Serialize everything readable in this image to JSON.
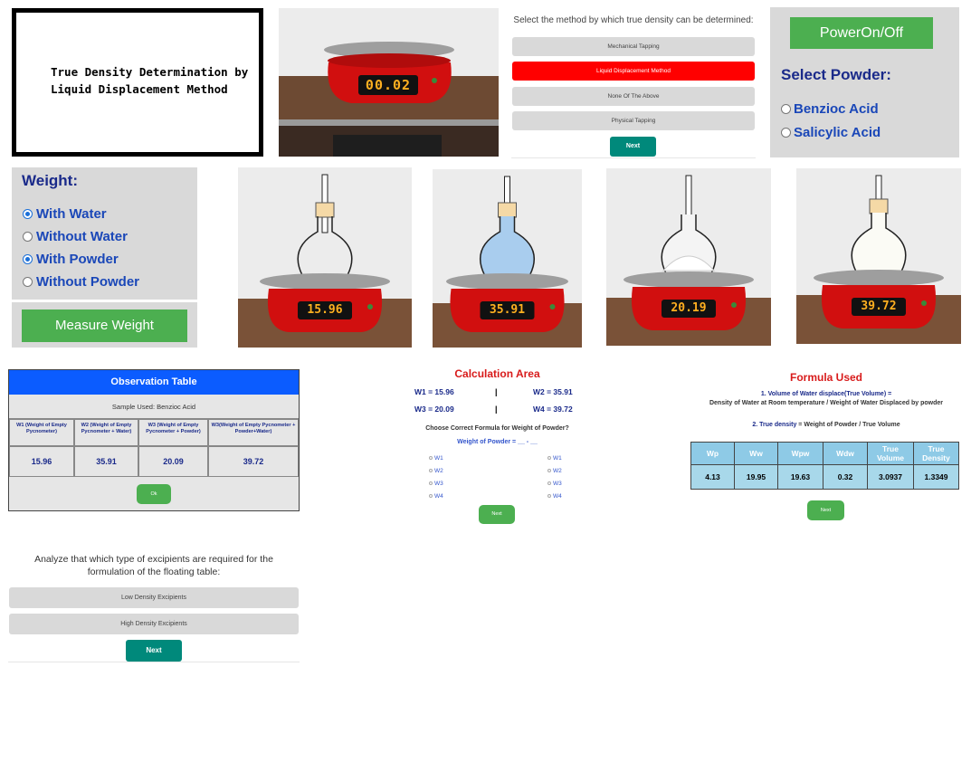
{
  "title_panel": {
    "line1": "True Density Determination by",
    "line2": "Liquid Displacement Method"
  },
  "top_scale": {
    "display": "00.02"
  },
  "method_quiz": {
    "question": "Select the method by which true density can be determined:",
    "options": [
      "Mechanical Tapping",
      "Liquid Displacement Method",
      "None Of The Above",
      "Physical Tapping"
    ],
    "selected": "Liquid Displacement Method",
    "next_label": "Next"
  },
  "power_panel": {
    "power_label": "PowerOn/Off",
    "select_label": "Select Powder:",
    "powders": [
      "Benzioc Acid",
      "Salicylic Acid"
    ]
  },
  "weight_panel": {
    "title": "Weight:",
    "options": [
      {
        "label": "With Water",
        "checked": true
      },
      {
        "label": "Without Water",
        "checked": false
      },
      {
        "label": "With Powder",
        "checked": true
      },
      {
        "label": "Without Powder",
        "checked": false
      }
    ],
    "measure_label": "Measure Weight"
  },
  "flask_scenes": [
    {
      "display": "15.96",
      "contents": "empty"
    },
    {
      "display": "35.91",
      "contents": "water"
    },
    {
      "display": "20.19",
      "contents": "powder"
    },
    {
      "display": "39.72",
      "contents": "powder+water"
    }
  ],
  "observation_table": {
    "title": "Observation Table",
    "sample": "Sample Used: Benzioc Acid",
    "headers": [
      "W1 (Weight of Empty Pycnometer)",
      "W2 (Weight of Empty Pycnometer + Water)",
      "W3 (Weight of Empty Pycnometer + Powder)",
      "W3(Weight of Empty Pycnometer + Powder+Water)"
    ],
    "values": [
      "15.96",
      "35.91",
      "20.09",
      "39.72"
    ],
    "ok_label": "Ok"
  },
  "calculation": {
    "title": "Calculation Area",
    "w1": "W1 = 15.96",
    "w2": "W2 = 35.91",
    "w3": "W3 = 20.09",
    "w4": "W4 = 39.72",
    "sep": "|",
    "question": "Choose Correct Formula for Weight of Powder?",
    "formula": "Weight of Powder = __ - __",
    "left_options": [
      "W1",
      "W2",
      "W3",
      "W4"
    ],
    "right_options": [
      "W1",
      "W2",
      "W3",
      "W4"
    ],
    "next_label": "Next"
  },
  "formula_panel": {
    "title": "Formula Used",
    "line1": "1. Volume of Water displace(True Volume) =",
    "line2": "Density of Water at Room temperature / Weight of Water Displaced by powder",
    "line3_prefix": "2. True density",
    "line3_rest": " = Weight of Powder / True Volume",
    "headers": [
      "Wp",
      "Ww",
      "Wpw",
      "Wdw",
      "True Volume",
      "True Density"
    ],
    "values": [
      "4.13",
      "19.95",
      "19.63",
      "0.32",
      "3.0937",
      "1.3349"
    ],
    "next_label": "Next"
  },
  "excipient": {
    "question": "Analyze that which type of excipients are required for the formulation of the floating table:",
    "options": [
      "Low Density Excipients",
      "High Density Excipients"
    ],
    "next_label": "Next"
  },
  "colors": {
    "blue_header": "#0b5cff",
    "green_button": "#4caf50",
    "teal_button": "#00897b",
    "selected_red": "#ff0000",
    "scale_red": "#d10f0f"
  }
}
